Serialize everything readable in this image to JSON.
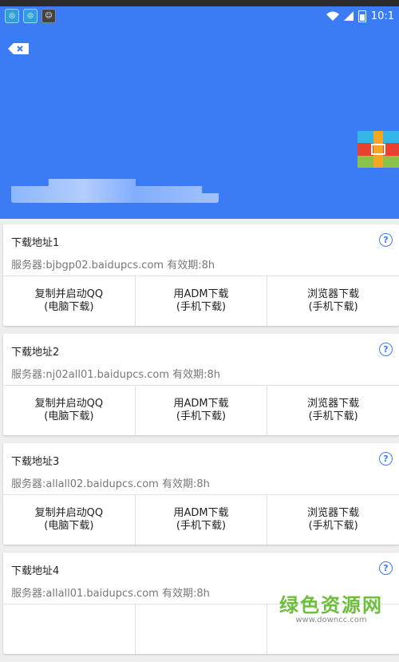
{
  "status_bar": {
    "time": "10:1"
  },
  "downloads": [
    {
      "title": "下载地址1",
      "server": "服务器:bjbgp02.baidupcs.com  有效期:8h"
    },
    {
      "title": "下载地址2",
      "server": "服务器:nj02all01.baidupcs.com  有效期:8h"
    },
    {
      "title": "下载地址3",
      "server": "服务器:allall02.baidupcs.com  有效期:8h"
    },
    {
      "title": "下载地址4",
      "server": "服务器:allall01.baidupcs.com  有效期:8h"
    }
  ],
  "actions": {
    "copy_qq": {
      "line1": "复制并启动QQ",
      "line2": "(电脑下载)"
    },
    "adm": {
      "line1": "用ADM下载",
      "line2": "(手机下载)"
    },
    "browser": {
      "line1": "浏览器下载",
      "line2": "(手机下载)"
    }
  },
  "watermark": {
    "main": "绿色资源网",
    "sub": "www.downcc.com"
  },
  "colors": {
    "header": "#3b7cf4",
    "help": "#3b7cf4",
    "watermark": "#6bbf3a"
  }
}
